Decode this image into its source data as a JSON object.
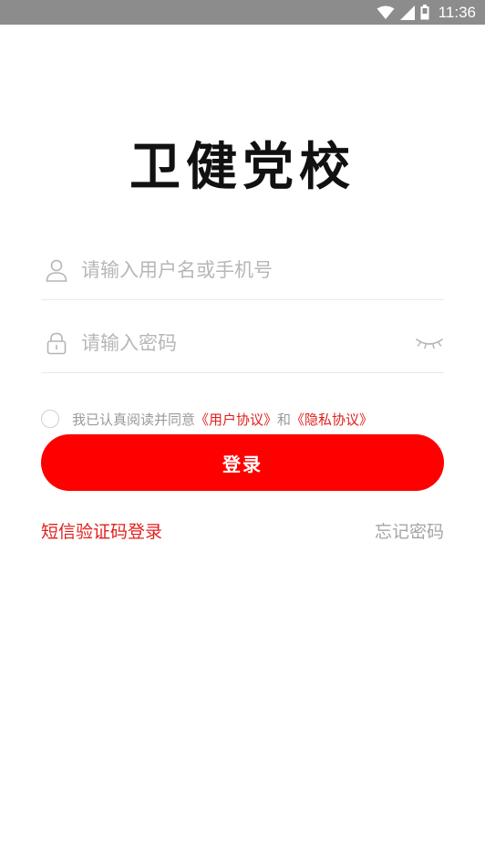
{
  "status_bar": {
    "time": "11:36",
    "icons": [
      "wifi-icon",
      "signal-icon",
      "battery-icon"
    ]
  },
  "logo": {
    "text": "卫健党校"
  },
  "form": {
    "username_placeholder": "请输入用户名或手机号",
    "username_value": "",
    "password_placeholder": "请输入密码",
    "password_value": "",
    "user_icon": "user-icon",
    "lock_icon": "lock-icon",
    "visibility_icon": "eye-closed-icon"
  },
  "agreement": {
    "checked": false,
    "prefix": "我已认真阅读并同意",
    "user_agreement": "《用户协议》",
    "conjunction": "和",
    "privacy_policy": "《隐私协议》"
  },
  "login_button": {
    "label": "登录"
  },
  "links": {
    "sms_login": "短信验证码登录",
    "forgot_password": "忘记密码"
  },
  "colors": {
    "primary": "#fe0000",
    "link_red": "#e0201c",
    "status_bar": "#8c8c8c",
    "placeholder": "#b7b7b7",
    "divider": "#e9e9e9"
  }
}
